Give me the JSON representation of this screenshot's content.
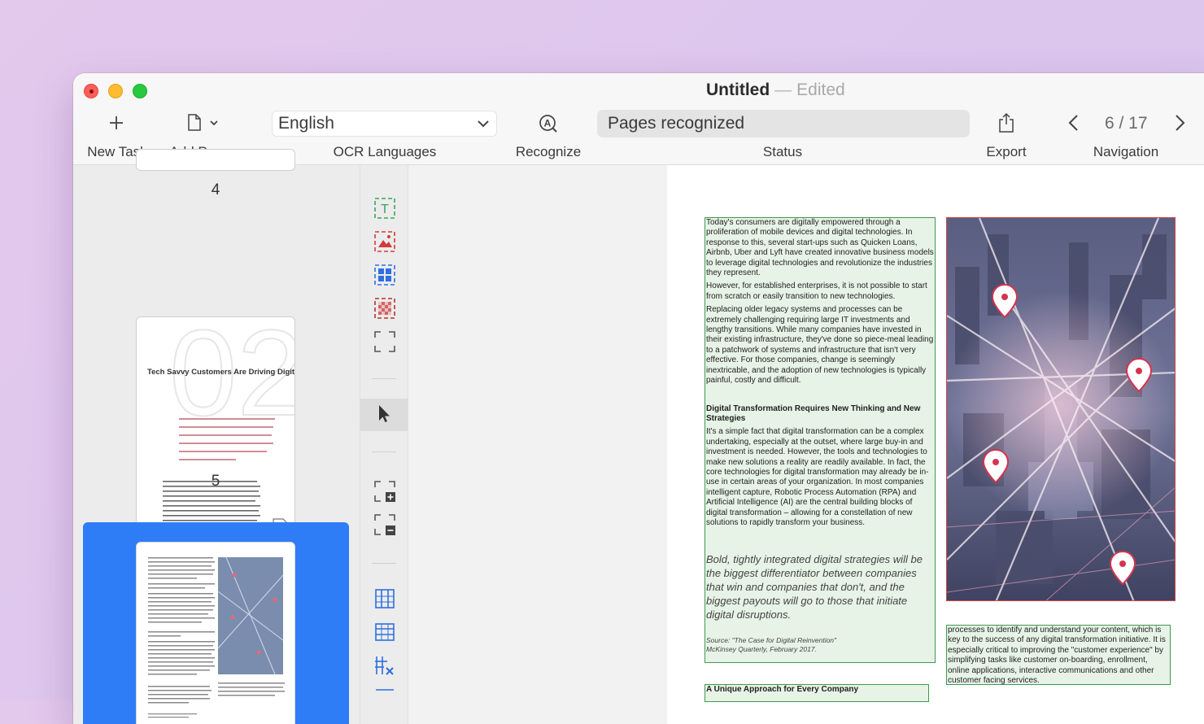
{
  "window": {
    "title": "Untitled",
    "separator": "—",
    "edited": "Edited"
  },
  "toolbar": {
    "new_task": "New Task",
    "add_pages": "Add Pages",
    "ocr_languages": "OCR Languages",
    "language_value": "English",
    "recognize": "Recognize",
    "status_label": "Status",
    "status_value": "Pages recognized",
    "export": "Export",
    "navigation": "Navigation",
    "page_counter": "6 / 17"
  },
  "sidebar": {
    "pages": [
      {
        "number": "4"
      },
      {
        "number": "5",
        "heading": "Tech Savvy Customers Are Driving Digital Transformation"
      }
    ]
  },
  "tools": [
    "text-area-icon",
    "picture-area-icon",
    "table-area-icon",
    "background-picture-icon",
    "area-select-icon",
    "pointer-icon",
    "add-area-icon",
    "remove-area-icon",
    "insert-column-icon",
    "insert-row-icon",
    "delete-separator-icon"
  ],
  "document": {
    "p1": "Today's consumers are digitally empowered through a proliferation of mobile devices and digital technologies. In response to this, several start-ups such as Quicken Loans, Airbnb, Uber and Lyft have created innovative business models to leverage digital technologies and revolutionize the industries they represent.",
    "p2": "However, for established enterprises, it is not possible to start from scratch or easily transition to new technologies.",
    "p3": "Replacing older legacy systems and processes can be extremely challenging requiring large IT investments and lengthy transitions. While many companies have invested in their existing infrastructure, they've done so piece-meal leading to a patchwork of systems and infrastructure that isn't very effective. For those companies, change is seemingly inextricable, and the adoption of new technologies is typically painful, costly and difficult.",
    "heading": "Digital Transformation Requires New Thinking and New Strategies",
    "p4": "It's a simple fact that digital transformation can be a complex undertaking, especially at the outset, where large buy-in and investment is needed. However, the tools and technologies to make new solutions a reality are readily available. In fact, the core technologies for digital transformation may already be in-use in certain areas of your organization. In most companies intelligent capture, Robotic Process Automation (RPA) and Artificial Intelligence (AI) are the central building blocks of digital transformation – allowing for a constellation of new solutions to rapidly transform your business.",
    "quote": "Bold, tightly integrated digital strategies will be the biggest differentiator between companies that win and companies that don't, and the biggest payouts will go to those that initiate digital disruptions.",
    "source1": "Source: \"The Case for Digital Reinvention\"",
    "source2": "McKinsey Quarterly, February 2017.",
    "right_text": "processes to identify and understand your content, which is key to the success of any digital transformation initiative. It is especially critical to improving the \"customer experience\" by simplifying tasks like customer on-boarding, enrollment, online applications, interactive communications and other customer facing services.",
    "bottom_heading": "A Unique Approach for Every Company"
  },
  "colors": {
    "accent": "#2f7df6",
    "text_area": "#3d9a4d",
    "picture_area": "#d24444"
  }
}
